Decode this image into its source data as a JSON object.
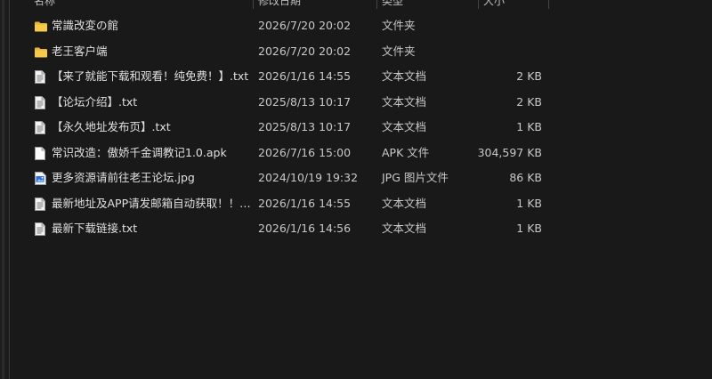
{
  "header": {
    "name_label": "名称",
    "date_label": "修改日期",
    "type_label": "类型",
    "size_label": "大小"
  },
  "files": [
    {
      "name": "常識改変の館",
      "date": "2026/7/20 20:02",
      "type": "文件夹",
      "size": "",
      "icon": "folder-icon"
    },
    {
      "name": "老王客户端",
      "date": "2026/7/20 20:02",
      "type": "文件夹",
      "size": "",
      "icon": "folder-icon"
    },
    {
      "name": "【来了就能下载和观看！纯免费！】.txt",
      "date": "2026/1/16 14:55",
      "type": "文本文档",
      "size": "2 KB",
      "icon": "text-file-icon"
    },
    {
      "name": "【论坛介绍】.txt",
      "date": "2025/8/13 10:17",
      "type": "文本文档",
      "size": "2 KB",
      "icon": "text-file-icon"
    },
    {
      "name": "【永久地址发布页】.txt",
      "date": "2025/8/13 10:17",
      "type": "文本文档",
      "size": "1 KB",
      "icon": "text-file-icon"
    },
    {
      "name": "常识改造：傲娇千金调教记1.0.apk",
      "date": "2026/7/16 15:00",
      "type": "APK 文件",
      "size": "304,597 KB",
      "icon": "blank-file-icon"
    },
    {
      "name": "更多资源请前往老王论坛.jpg",
      "date": "2024/10/19 19:32",
      "type": "JPG 图片文件",
      "size": "86 KB",
      "icon": "image-file-icon"
    },
    {
      "name": "最新地址及APP请发邮箱自动获取！！！...",
      "date": "2026/1/16 14:55",
      "type": "文本文档",
      "size": "1 KB",
      "icon": "text-file-icon"
    },
    {
      "name": "最新下载链接.txt",
      "date": "2026/1/16 14:56",
      "type": "文本文档",
      "size": "1 KB",
      "icon": "text-file-icon"
    }
  ]
}
